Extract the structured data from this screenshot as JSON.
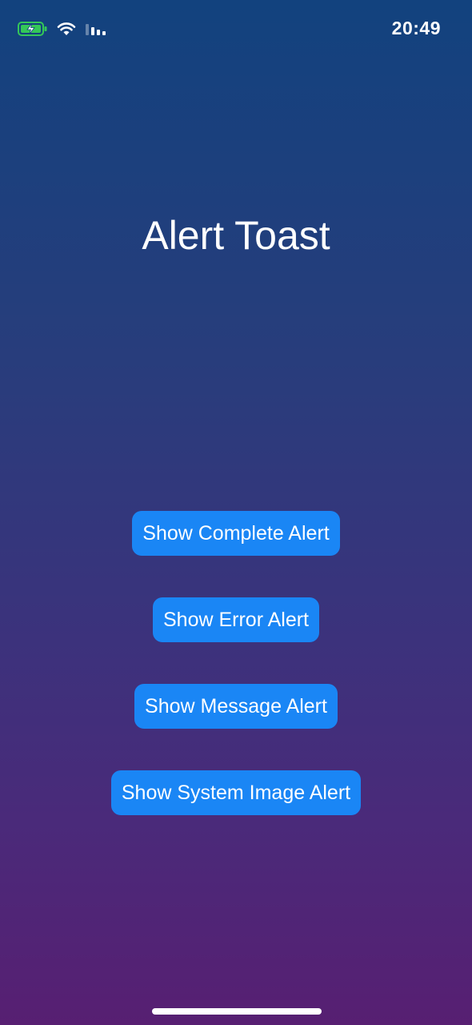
{
  "status_bar": {
    "time": "20:49",
    "icons": [
      "battery-charging-icon",
      "wifi-icon",
      "cellular-signal-icon"
    ]
  },
  "screen": {
    "title": "Alert Toast"
  },
  "buttons": {
    "complete": "Show Complete Alert",
    "error": "Show Error Alert",
    "message": "Show Message Alert",
    "system_image": "Show System Image Alert"
  },
  "colors": {
    "button_background": "#1a86f5",
    "gradient_top": "#12427e",
    "gradient_bottom": "#571f72",
    "battery_fill": "#34c759"
  }
}
